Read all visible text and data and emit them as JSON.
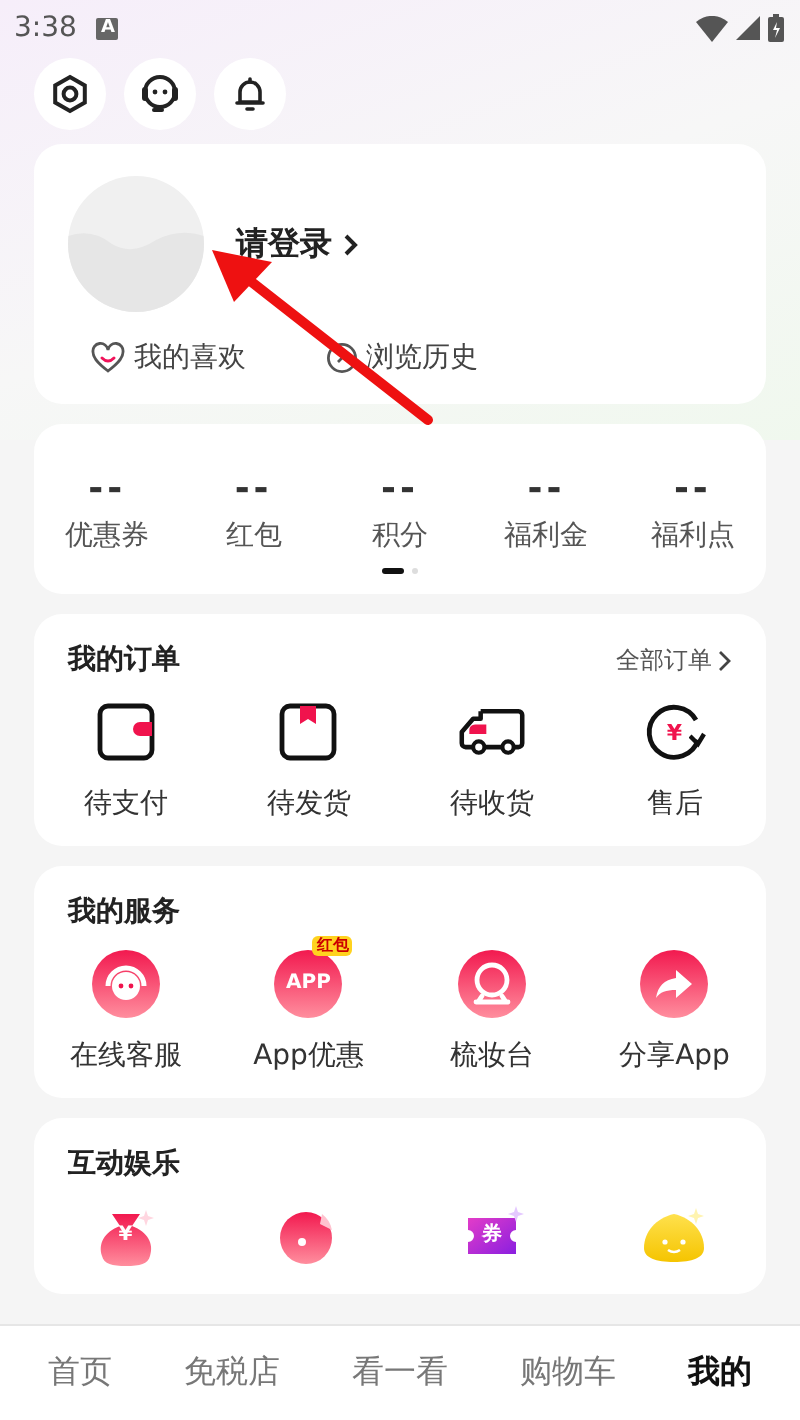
{
  "status_bar": {
    "time": "3:38",
    "indicator": "A"
  },
  "top_actions": [
    {
      "kind": "settings"
    },
    {
      "kind": "support"
    },
    {
      "kind": "bell"
    }
  ],
  "profile": {
    "login": "请登录",
    "links": [
      {
        "kind": "heart",
        "label": "我的喜欢"
      },
      {
        "kind": "clock",
        "label": "浏览历史"
      }
    ]
  },
  "stats": {
    "items": [
      {
        "value": "--",
        "label": "优惠券"
      },
      {
        "value": "--",
        "label": "红包"
      },
      {
        "value": "--",
        "label": "积分"
      },
      {
        "value": "--",
        "label": "福利金"
      },
      {
        "value": "--",
        "label": "福利点"
      }
    ],
    "pages": [
      {
        "selected": true
      },
      {
        "selected": false
      }
    ]
  },
  "orders": {
    "title": "我的订单",
    "more": "全部订单",
    "items": [
      {
        "kind": "pay",
        "label": "待支付"
      },
      {
        "kind": "ship",
        "label": "待发货"
      },
      {
        "kind": "receive",
        "label": "待收货"
      },
      {
        "kind": "refund",
        "label": "售后",
        "icon_text": "¥"
      }
    ]
  },
  "services": {
    "title": "我的服务",
    "items": [
      {
        "kind": "headset",
        "label": "在线客服"
      },
      {
        "kind": "app",
        "label": "App优惠",
        "icon_text": "APP",
        "badge": "红包"
      },
      {
        "kind": "mirror",
        "label": "梳妆台"
      },
      {
        "kind": "share",
        "label": "分享App"
      }
    ]
  },
  "fun": {
    "title": "互动娱乐",
    "items": [
      {
        "kind": "bag",
        "icon_text": "¥"
      },
      {
        "kind": "disc"
      },
      {
        "kind": "coupon",
        "icon_text": "券"
      },
      {
        "kind": "bun"
      }
    ]
  },
  "tab_bar": [
    {
      "label": "首页",
      "selected": false
    },
    {
      "label": "免税店",
      "selected": false
    },
    {
      "label": "看一看",
      "selected": false
    },
    {
      "label": "购物车",
      "selected": false
    },
    {
      "label": "我的",
      "selected": true
    }
  ]
}
